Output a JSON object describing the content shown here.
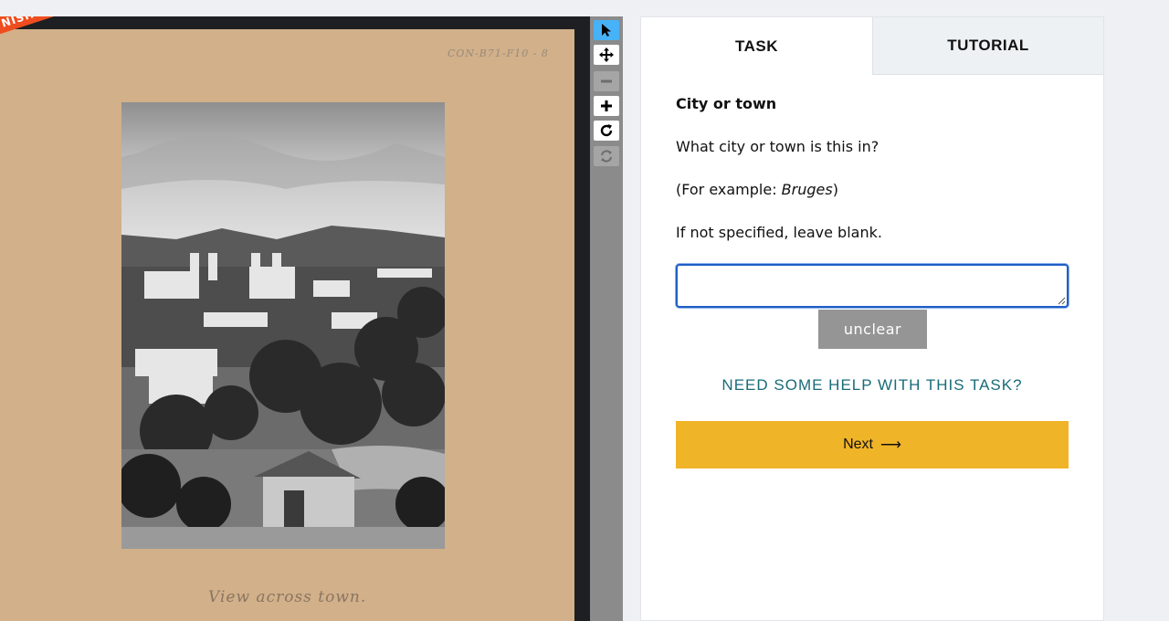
{
  "viewer": {
    "ribbon_text": "NISHED!",
    "catalog_id": "CON-B71-F10 - 8",
    "handwritten_caption": "View across town."
  },
  "toolbar": {
    "tools": [
      {
        "name": "select",
        "icon": "cursor-arrow-icon",
        "state": "active"
      },
      {
        "name": "pan",
        "icon": "move-arrows-icon",
        "state": "enabled"
      },
      {
        "name": "zoom-out",
        "icon": "minus-icon",
        "state": "disabled"
      },
      {
        "name": "zoom-in",
        "icon": "plus-icon",
        "state": "enabled"
      },
      {
        "name": "rotate",
        "icon": "rotate-icon",
        "state": "enabled"
      },
      {
        "name": "reset",
        "icon": "reset-icon",
        "state": "disabled"
      }
    ]
  },
  "tabs": {
    "task": "TASK",
    "tutorial": "TUTORIAL"
  },
  "task": {
    "title": "City or town",
    "question": "What city or town is this in?",
    "example_prefix": "(For example: ",
    "example_value": "Bruges",
    "example_suffix": ")",
    "instruction": "If not specified, leave blank.",
    "answer_value": "",
    "unclear_label": "unclear",
    "help_link": "NEED SOME HELP WITH THIS TASK?",
    "next_label": "Next",
    "next_arrow": "⟶"
  },
  "colors": {
    "accent_blue": "#1f5fc4",
    "next_yellow": "#f0b429",
    "help_teal": "#186b79",
    "ribbon_orange": "#ef4d1f",
    "active_tool": "#47b2f7"
  }
}
